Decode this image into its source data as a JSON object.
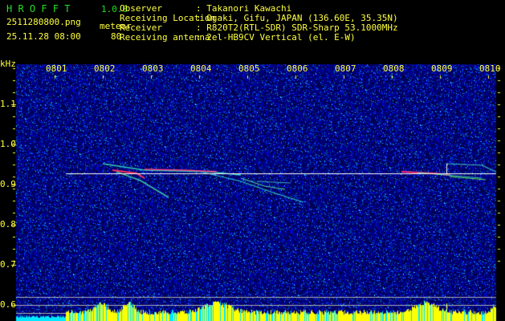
{
  "header": {
    "app_name": "H R O F F T",
    "version": "1.0.0",
    "filename": "2511280800.png",
    "datetime": "25.11.28 08:00",
    "meteor_label": "meteor",
    "meteor_count": "80",
    "info": [
      {
        "label": "Observer",
        "value": ": Takanori Kawachi"
      },
      {
        "label": "Receiving Location",
        "value": ": Ogaki, Gifu, JAPAN (136.60E, 35.35N)"
      },
      {
        "label": "Receiver",
        "value": ": R820T2(RTL-SDR) SDR-Sharp 53.1000MHz"
      },
      {
        "label": "Receiving antenna",
        "value": ": 2el-HB9CV Vertical (el. E-W)"
      }
    ]
  },
  "spectrogram": {
    "y_unit": "kHz",
    "y_ticks": [
      "1.1",
      "1.0",
      "0.9",
      "0.8",
      "0.7",
      "0.6"
    ],
    "x_ticks": [
      "0801",
      "0802",
      "0803",
      "0804",
      "0805",
      "0806",
      "0807",
      "0808",
      "0809",
      "0810"
    ],
    "colors": {
      "background": "#000000",
      "noise": "#1010c0",
      "text": "#ffff40",
      "title": "#20e020",
      "histogram": "#ffff00",
      "histogram_low": "#00e8ff",
      "carrier": "#ffffff"
    }
  }
}
